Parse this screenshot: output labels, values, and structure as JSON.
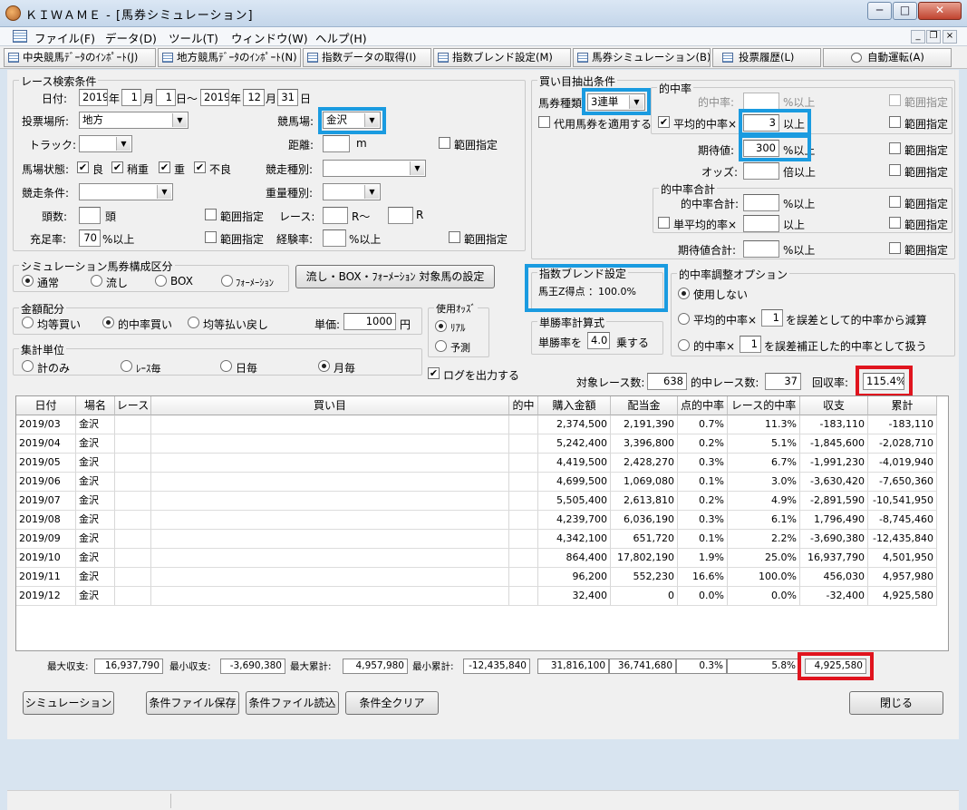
{
  "window": {
    "title": "ＫＩＷＡＭＥ - [馬券シミュレーション]",
    "minimize": "─",
    "maximize": "□",
    "close": "✕"
  },
  "menu": [
    "ファイル(F)",
    "データ(D)",
    "ツール(T)",
    "ウィンドウ(W)",
    "ヘルプ(H)"
  ],
  "mdi": {
    "min": "_",
    "restore": "❐",
    "close": "×"
  },
  "toolbar": [
    "中央競馬ﾃﾞｰﾀのｲﾝﾎﾟｰﾄ(J)",
    "地方競馬ﾃﾞｰﾀのｲﾝﾎﾟｰﾄ(N)",
    "指数データの取得(I)",
    "指数ブレンド設定(M)",
    "馬券シミュレーション(B)",
    "投票履歴(L)",
    "自動運転(A)"
  ],
  "race": {
    "group": "レース検索条件",
    "date_label": "日付:",
    "y1": "2019",
    "m1": "1",
    "d1": "1",
    "y2": "2019",
    "m2": "12",
    "d2": "31",
    "nen": "年",
    "tsuki": "月",
    "hi_tilde": "日～",
    "hi": "日",
    "venue_label": "投票場所:",
    "venue": "地方",
    "track_label": "競馬場:",
    "track": "金沢",
    "course_label": "トラック:",
    "distance_label": "距離:",
    "m": "m",
    "range": "範囲指定",
    "cond_label": "馬場状態:",
    "c1": "良",
    "c2": "稍重",
    "c3": "重",
    "c4": "不良",
    "type_label": "競走種別:",
    "racecond_label": "競走条件:",
    "weight_label": "重量種別:",
    "heads_label": "頭数:",
    "heads_unit": "頭",
    "race_label": "レース:",
    "r_tilde": "R～",
    "r": "R",
    "fill_label": "充足率:",
    "fill": "70",
    "pct_over": "%以上",
    "exp_label": "経験率:"
  },
  "sim": {
    "group": "シミュレーション馬券構成区分",
    "o1": "通常",
    "o2": "流し",
    "o3": "BOX",
    "o4": "ﾌｫｰﾒｰｼｮﾝ",
    "btn": "流し・BOX・ﾌｫｰﾒｰｼｮﾝ 対象馬の設定"
  },
  "money": {
    "group": "金額配分",
    "o1": "均等買い",
    "o2": "的中率買い",
    "o3": "均等払い戻し",
    "unit_label": "単価:",
    "unit": "1000",
    "yen": "円"
  },
  "odds": {
    "group": "使用ｵｯｽﾞ",
    "o1": "ﾘｱﾙ",
    "o2": "予測"
  },
  "agg": {
    "group": "集計単位",
    "o1": "計のみ",
    "o2": "ﾚｰｽ毎",
    "o3": "日毎",
    "o4": "月毎"
  },
  "log": "ログを出力する",
  "bet": {
    "group": "買い目抽出条件",
    "type_label": "馬券種類",
    "type": "3連単",
    "subst": "代用馬券を適用する",
    "hit_group": "的中率",
    "hit_label": "的中率:",
    "pct": "%以上",
    "avg_label": "平均的中率×",
    "avg": "3",
    "ijou": "以上",
    "exp_label": "期待値:",
    "exp": "300",
    "odds_label": "オッズ:",
    "bai": "倍以上",
    "range": "範囲指定",
    "sum_group": "的中率合計",
    "sum_label": "的中率合計:",
    "savg_label": "単平均的率×",
    "expsum_label": "期待値合計:"
  },
  "blend": {
    "group": "指数ブレンド設定",
    "text": "馬王Z得点 ：100.0%"
  },
  "tansho": {
    "group": "単勝率計算式",
    "pre": "単勝率を",
    "val": "4.0",
    "post": "乗する"
  },
  "adj": {
    "group": "的中率調整オプション",
    "o1": "使用しない",
    "o2a": "平均的中率×",
    "o2v": "1",
    "o2b": "を誤差として的中率から減算",
    "o3a": "的中率×",
    "o3v": "1",
    "o3b": "を誤差補正した的中率として扱う"
  },
  "summary": {
    "l1": "対象レース数:",
    "v1": "638",
    "l2": "的中レース数:",
    "v2": "37",
    "l3": "回収率:",
    "v3": "115.4%"
  },
  "table": {
    "headers": [
      "日付",
      "場名",
      "レース",
      "買い目",
      "的中",
      "購入金額",
      "配当金",
      "点的中率",
      "レース的中率",
      "収支",
      "累計"
    ],
    "rows": [
      [
        "2019/03",
        "金沢",
        "",
        "",
        "",
        "2,374,500",
        "2,191,390",
        "0.7%",
        "11.3%",
        "-183,110",
        "-183,110"
      ],
      [
        "2019/04",
        "金沢",
        "",
        "",
        "",
        "5,242,400",
        "3,396,800",
        "0.2%",
        "5.1%",
        "-1,845,600",
        "-2,028,710"
      ],
      [
        "2019/05",
        "金沢",
        "",
        "",
        "",
        "4,419,500",
        "2,428,270",
        "0.3%",
        "6.7%",
        "-1,991,230",
        "-4,019,940"
      ],
      [
        "2019/06",
        "金沢",
        "",
        "",
        "",
        "4,699,500",
        "1,069,080",
        "0.1%",
        "3.0%",
        "-3,630,420",
        "-7,650,360"
      ],
      [
        "2019/07",
        "金沢",
        "",
        "",
        "",
        "5,505,400",
        "2,613,810",
        "0.2%",
        "4.9%",
        "-2,891,590",
        "-10,541,950"
      ],
      [
        "2019/08",
        "金沢",
        "",
        "",
        "",
        "4,239,700",
        "6,036,190",
        "0.3%",
        "6.1%",
        "1,796,490",
        "-8,745,460"
      ],
      [
        "2019/09",
        "金沢",
        "",
        "",
        "",
        "4,342,100",
        "651,720",
        "0.1%",
        "2.2%",
        "-3,690,380",
        "-12,435,840"
      ],
      [
        "2019/10",
        "金沢",
        "",
        "",
        "",
        "864,400",
        "17,802,190",
        "1.9%",
        "25.0%",
        "16,937,790",
        "4,501,950"
      ],
      [
        "2019/11",
        "金沢",
        "",
        "",
        "",
        "96,200",
        "552,230",
        "16.6%",
        "100.0%",
        "456,030",
        "4,957,980"
      ],
      [
        "2019/12",
        "金沢",
        "",
        "",
        "",
        "32,400",
        "0",
        "0.0%",
        "0.0%",
        "-32,400",
        "4,925,580"
      ]
    ]
  },
  "stats": {
    "l1": "最大収支:",
    "v1": "16,937,790",
    "l2": "最小収支:",
    "v2": "-3,690,380",
    "l3": "最大累計:",
    "v3": "4,957,980",
    "l4": "最小累計:",
    "v4": "-12,435,840",
    "buy": "31,816,100",
    "pay": "36,741,680",
    "hit": "0.3%",
    "rhit": "5.8%",
    "cum": "4,925,580"
  },
  "buttons": {
    "sim": "シミュレーション",
    "save": "条件ファイル保存",
    "load": "条件ファイル読込",
    "clear": "条件全クリア",
    "close": "閉じる"
  }
}
